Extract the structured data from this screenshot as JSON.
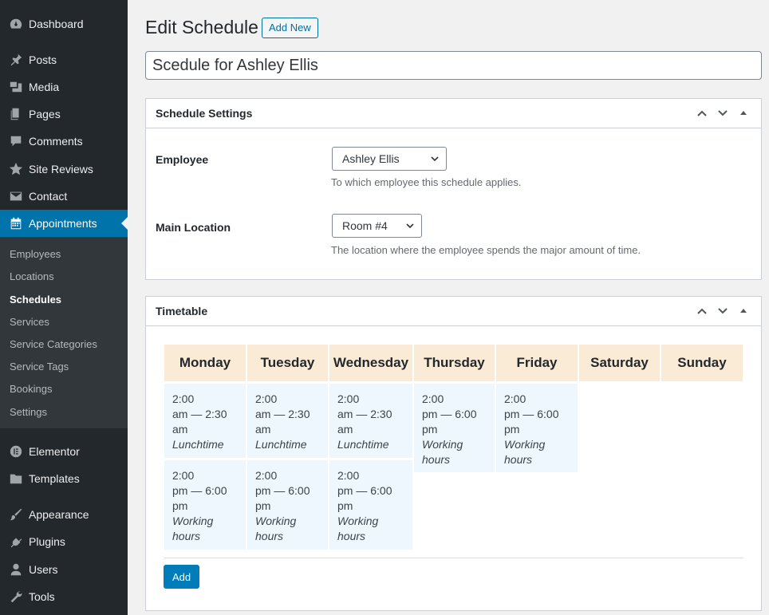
{
  "sidebar": {
    "items": [
      {
        "label": "Dashboard",
        "icon": "dashboard-icon"
      },
      {
        "label": "Posts",
        "icon": "pin-icon"
      },
      {
        "label": "Media",
        "icon": "media-icon"
      },
      {
        "label": "Pages",
        "icon": "pages-icon"
      },
      {
        "label": "Comments",
        "icon": "comment-icon"
      },
      {
        "label": "Site Reviews",
        "icon": "star-icon"
      },
      {
        "label": "Contact",
        "icon": "mail-icon"
      },
      {
        "label": "Appointments",
        "icon": "calendar-icon"
      },
      {
        "label": "Elementor",
        "icon": "elementor-icon"
      },
      {
        "label": "Templates",
        "icon": "folder-icon"
      },
      {
        "label": "Appearance",
        "icon": "brush-icon"
      },
      {
        "label": "Plugins",
        "icon": "plug-icon"
      },
      {
        "label": "Users",
        "icon": "user-icon"
      },
      {
        "label": "Tools",
        "icon": "wrench-icon"
      }
    ],
    "submenu": [
      "Employees",
      "Locations",
      "Schedules",
      "Services",
      "Service Categories",
      "Service Tags",
      "Bookings",
      "Settings"
    ]
  },
  "header": {
    "title": "Edit Schedule",
    "add_new": "Add New"
  },
  "post_title": "Scedule for Ashley Ellis",
  "settings_box": {
    "title": "Schedule Settings",
    "employee_label": "Employee",
    "employee_value": "Ashley Ellis",
    "employee_desc": "To which employee this schedule applies.",
    "location_label": "Main Location",
    "location_value": "Room #4",
    "location_desc": "The location where the employee spends the major amount of time."
  },
  "timetable_box": {
    "title": "Timetable",
    "days": [
      "Monday",
      "Tuesday",
      "Wednesday",
      "Thursday",
      "Friday",
      "Saturday",
      "Sunday"
    ],
    "slots": [
      {
        "time1": "2:00",
        "time2": "am — 2:30",
        "time3": "am",
        "note": "Lunchtime"
      },
      {
        "time1": "2:00",
        "time2": "am — 2:30",
        "time3": "am",
        "note": "Lunchtime"
      },
      {
        "time1": "2:00",
        "time2": "am — 2:30",
        "time3": "am",
        "note": "Lunchtime"
      },
      {
        "time1": "2:00",
        "time2": "pm — 6:00",
        "time3": "pm",
        "note1": "Working",
        "note2": "hours"
      },
      {
        "time1": "2:00",
        "time2": "pm — 6:00",
        "time3": "pm",
        "note1": "Working",
        "note2": "hours"
      },
      {
        "time1": "2:00",
        "time2": "pm — 6:00",
        "time3": "pm",
        "note1": "Working",
        "note2": "hours"
      },
      {
        "time1": "2:00",
        "time2": "pm — 6:00",
        "time3": "pm",
        "note1": "Working",
        "note2": "hours"
      },
      {
        "time1": "2:00",
        "time2": "pm — 6:00",
        "time3": "pm",
        "note1": "Working",
        "note2": "hours"
      }
    ],
    "add_label": "Add"
  },
  "colors": {
    "sidebar_bg": "#23282d",
    "submenu_bg": "#32373c",
    "accent": "#0073aa",
    "day_header_bg": "#faebd7",
    "slot_bg": "#eef7fd"
  }
}
